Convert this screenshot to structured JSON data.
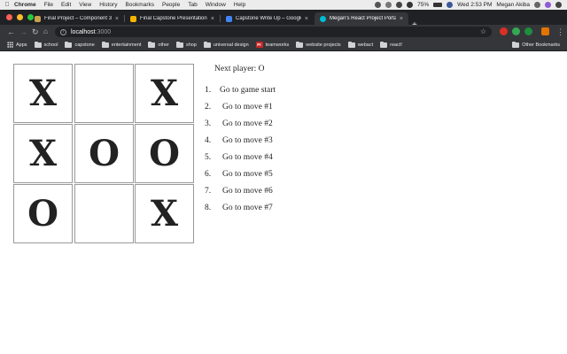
{
  "menubar": {
    "app": "Chrome",
    "items": [
      "File",
      "Edit",
      "View",
      "History",
      "Bookmarks",
      "People",
      "Tab",
      "Window",
      "Help"
    ],
    "battery": "75%",
    "clock": "Wed 2:53 PM",
    "user": "Megan Akiba"
  },
  "tabs": [
    {
      "title": "Final Project – Component 3 ch",
      "favicon_color": "#c8a24a"
    },
    {
      "title": "Final Capstone Presentation - G",
      "favicon_color": "#f4b400"
    },
    {
      "title": "Capstone Write Up – Google Do",
      "favicon_color": "#4285f4"
    },
    {
      "title": "Megan's React Project Portal",
      "favicon_color": "#00bcd4"
    }
  ],
  "toolbar": {
    "url_host": "localhost",
    "url_port": ":3000"
  },
  "bookmarks": {
    "apps_label": "Apps",
    "items": [
      "school",
      "capstone",
      "entertainment",
      "other",
      "shop",
      "universal design",
      "teamworks",
      "website projects",
      "webact",
      "react!"
    ],
    "pr_badge": "Pr",
    "other_label": "Other Bookmarks"
  },
  "game": {
    "status": "Next player: O",
    "squares": [
      "X",
      "",
      "X",
      "X",
      "O",
      "O",
      "O",
      "",
      "X"
    ],
    "moves": [
      {
        "number": "1.",
        "label": "Go to game start"
      },
      {
        "number": "2.",
        "label": "Go to move #1"
      },
      {
        "number": "3.",
        "label": "Go to move #2"
      },
      {
        "number": "4.",
        "label": "Go to move #3"
      },
      {
        "number": "5.",
        "label": "Go to move #4"
      },
      {
        "number": "6.",
        "label": "Go to move #5"
      },
      {
        "number": "7.",
        "label": "Go to move #6"
      },
      {
        "number": "8.",
        "label": "Go to move #7"
      }
    ]
  }
}
